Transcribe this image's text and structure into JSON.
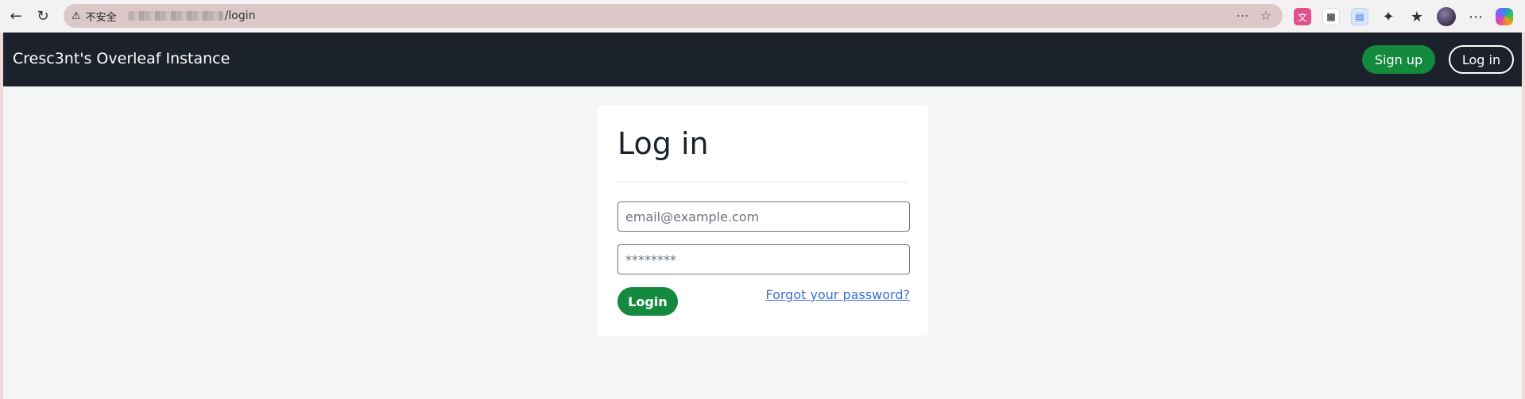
{
  "browser": {
    "security_label": "不安全",
    "url_path": "/login",
    "icons": [
      "back-icon",
      "reload-icon",
      "warning-icon",
      "reader-icon",
      "star-icon",
      "translate-icon",
      "tab-icon",
      "document-icon",
      "puzzle-icon",
      "favorites-icon",
      "avatar",
      "more-icon",
      "copilot-icon"
    ]
  },
  "navbar": {
    "brand": "Cresc3nt's Overleaf Instance",
    "signup_label": "Sign up",
    "login_label": "Log in"
  },
  "login_form": {
    "title": "Log in",
    "email_placeholder": "email@example.com",
    "password_placeholder": "********",
    "submit_label": "Login",
    "forgot_label": "Forgot your password?"
  },
  "colors": {
    "navbar_bg": "#1b222c",
    "primary_green": "#138a3e",
    "link_blue": "#3b6fce",
    "page_bg": "#f4f5f6"
  }
}
